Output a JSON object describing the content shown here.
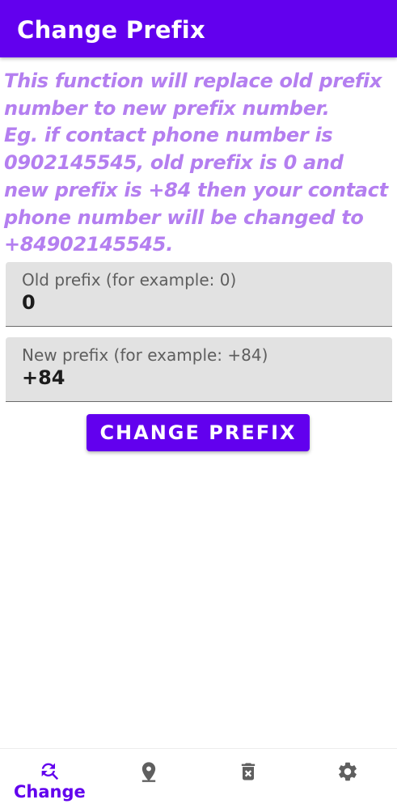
{
  "app_bar": {
    "title": "Change Prefix"
  },
  "description": {
    "lines": [
      "This function will replace old prefix",
      "number to new prefix number.",
      "Eg. if contact phone number is",
      "0902145545, old prefix is 0 and",
      "new prefix is +84 then your contact",
      "phone number will be changed to",
      "+84902145545."
    ]
  },
  "old_prefix": {
    "label": "Old prefix (for example: 0)",
    "value": "0"
  },
  "new_prefix": {
    "label": "New prefix (for example: +84)",
    "value": "+84"
  },
  "action": {
    "label": "CHANGE PREFIX"
  },
  "bottom_nav": {
    "items": [
      {
        "label": "Change",
        "icon": "find-replace-icon",
        "active": true
      },
      {
        "label": "",
        "icon": "location-pin-icon",
        "active": false
      },
      {
        "label": "",
        "icon": "delete-icon",
        "active": false
      },
      {
        "label": "",
        "icon": "settings-icon",
        "active": false
      }
    ]
  },
  "colors": {
    "primary": "#6200ee",
    "description_text": "#b47ff0",
    "field_background": "#e2e2e2",
    "inactive_icon": "#5f5f5f"
  }
}
